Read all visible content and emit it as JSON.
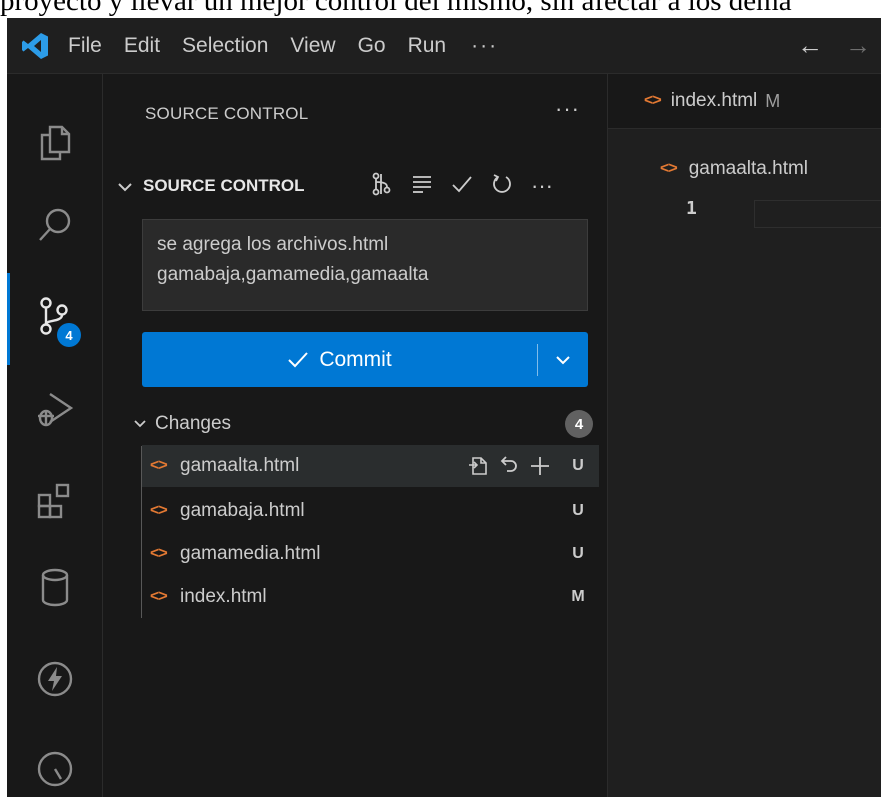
{
  "top_text": "proyecto y llevar un mejor control del mismo, sin afectar a los dema",
  "menu": {
    "items": [
      "File",
      "Edit",
      "Selection",
      "View",
      "Go",
      "Run"
    ],
    "more": "···"
  },
  "activity": {
    "scm_badge": "4"
  },
  "sidebar": {
    "title": "SOURCE CONTROL",
    "more": "···",
    "section_title": "SOURCE CONTROL",
    "commit_message": "se agrega los archivos.html gamabaja,gamamedia,gamaalta",
    "commit_label": "Commit",
    "changes_label": "Changes",
    "changes_count": "4",
    "files": [
      {
        "name": "gamaalta.html",
        "status": "U"
      },
      {
        "name": "gamabaja.html",
        "status": "U"
      },
      {
        "name": "gamamedia.html",
        "status": "U"
      },
      {
        "name": "index.html",
        "status": "M"
      }
    ]
  },
  "editor": {
    "tab_name": "index.html",
    "tab_status": "M",
    "breadcrumb": "gamaalta.html",
    "line_number": "1"
  },
  "colors": {
    "accent": "#0078d4",
    "html_icon": "#e37933",
    "background": "#181818"
  },
  "icons": {
    "file_type": "html-brackets-icon"
  }
}
